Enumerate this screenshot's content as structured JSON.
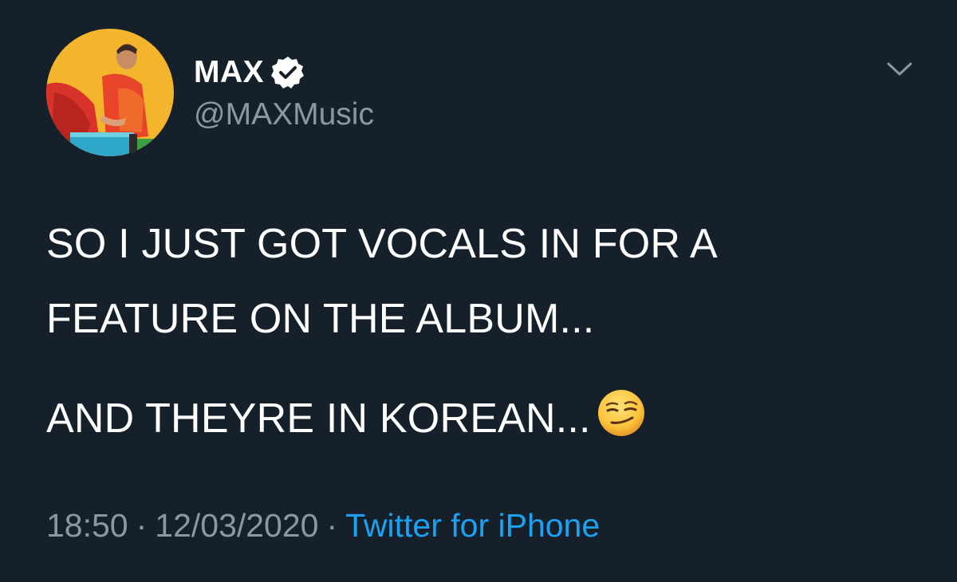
{
  "author": {
    "display_name": "MAX",
    "handle": "@MAXMusic",
    "verified": true
  },
  "tweet": {
    "line1": "SO I JUST GOT VOCALS IN FOR A",
    "line2": "FEATURE ON THE ALBUM...",
    "line3": "AND THEYRE IN KOREAN...",
    "emoji": "smirking-face-emoji"
  },
  "meta": {
    "time": "18:50",
    "separator": "·",
    "date": "12/03/2020",
    "source": "Twitter for iPhone"
  },
  "colors": {
    "background": "#15202b",
    "text": "#ffffff",
    "secondary": "#8899a6",
    "link": "#1da1f2"
  },
  "icons": {
    "verified": "verified-badge-icon",
    "menu": "chevron-down-icon"
  }
}
